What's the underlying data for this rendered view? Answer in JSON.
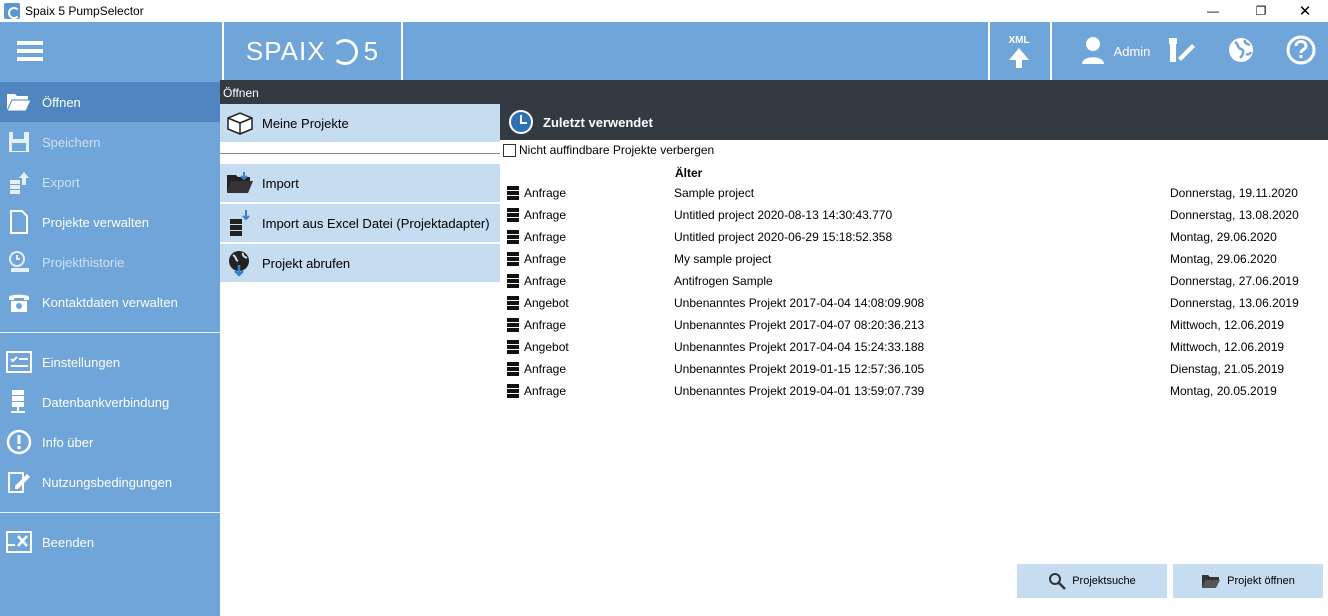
{
  "window": {
    "title": "Spaix 5 PumpSelector",
    "controls": {
      "minimize": "—",
      "maximize": "❐",
      "close": "✕"
    }
  },
  "topbar": {
    "logo_left": "SPAIX",
    "logo_right": "5",
    "xml_label": "XML",
    "user_label": "Admin"
  },
  "sidebar": {
    "items": [
      {
        "label": "Öffnen",
        "icon": "folder-open-icon",
        "active": true
      },
      {
        "label": "Speichern",
        "icon": "floppy-icon",
        "dim": true
      },
      {
        "label": "Export",
        "icon": "export-icon",
        "dim": true
      },
      {
        "label": "Projekte verwalten",
        "icon": "document-icon",
        "dim": false
      },
      {
        "label": "Projekthistorie",
        "icon": "history-icon",
        "dim": true
      },
      {
        "label": "Kontaktdaten verwalten",
        "icon": "phone-icon",
        "dim": false
      }
    ],
    "items2": [
      {
        "label": "Einstellungen",
        "icon": "settings-icon"
      },
      {
        "label": "Datenbankverbindung",
        "icon": "database-icon"
      },
      {
        "label": "Info über",
        "icon": "info-icon"
      },
      {
        "label": "Nutzungsbedingungen",
        "icon": "terms-icon"
      }
    ],
    "items3": [
      {
        "label": "Beenden",
        "icon": "exit-icon"
      }
    ]
  },
  "section": {
    "title": "Öffnen"
  },
  "subnav": {
    "my_projects": "Meine Projekte",
    "import": "Import",
    "import_excel": "Import aus Excel Datei (Projektadapter)",
    "fetch": "Projekt abrufen"
  },
  "recent": {
    "title": "Zuletzt verwendet",
    "hide_label": "Nicht auffindbare Projekte verbergen",
    "group_label": "Älter",
    "rows": [
      {
        "type": "Anfrage",
        "name": "Sample project",
        "date": "Donnerstag, 19.11.2020"
      },
      {
        "type": "Anfrage",
        "name": "Untitled project 2020-08-13 14:30:43.770",
        "date": "Donnerstag, 13.08.2020"
      },
      {
        "type": "Anfrage",
        "name": "Untitled project 2020-06-29 15:18:52.358",
        "date": "Montag, 29.06.2020"
      },
      {
        "type": "Anfrage",
        "name": "My sample project",
        "date": "Montag, 29.06.2020"
      },
      {
        "type": "Anfrage",
        "name": "Antifrogen Sample",
        "date": "Donnerstag, 27.06.2019"
      },
      {
        "type": "Angebot",
        "name": "Unbenanntes Projekt 2017-04-04 14:08:09.908",
        "date": "Donnerstag, 13.06.2019"
      },
      {
        "type": "Anfrage",
        "name": "Unbenanntes Projekt 2017-04-07 08:20:36.213",
        "date": "Mittwoch, 12.06.2019"
      },
      {
        "type": "Angebot",
        "name": "Unbenanntes Projekt 2017-04-04 15:24:33.188",
        "date": "Mittwoch, 12.06.2019"
      },
      {
        "type": "Anfrage",
        "name": "Unbenanntes Projekt 2019-01-15 12:57:36.105",
        "date": "Dienstag, 21.05.2019"
      },
      {
        "type": "Anfrage",
        "name": "Unbenanntes Projekt 2019-04-01 13:59:07.739",
        "date": "Montag, 20.05.2019"
      }
    ]
  },
  "buttons": {
    "search": "Projektsuche",
    "open": "Projekt öffnen"
  },
  "colors": {
    "sidebar": "#6fa5d9",
    "sidebar_active": "#4f86c0",
    "header_dark": "#333a42",
    "light_panel": "#c6dcf0"
  }
}
